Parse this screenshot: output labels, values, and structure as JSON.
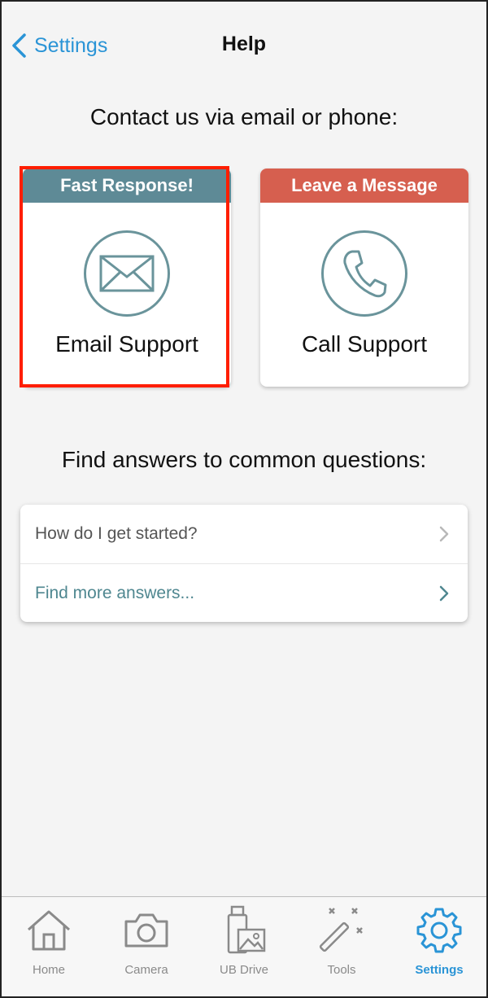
{
  "navbar": {
    "back_label": "Settings",
    "title": "Help"
  },
  "contact": {
    "heading": "Contact us via email or phone:",
    "email_card": {
      "banner": "Fast Response!",
      "label": "Email Support",
      "icon": "envelope-icon",
      "banner_color": "#5e8a96"
    },
    "call_card": {
      "banner": "Leave a Message",
      "label": "Call Support",
      "icon": "phone-icon",
      "banner_color": "#d65f4f"
    }
  },
  "faq": {
    "heading": "Find answers to common questions:",
    "items": [
      {
        "label": "How do I get started?"
      },
      {
        "label": "Find more answers..."
      }
    ]
  },
  "tabbar": {
    "items": [
      {
        "label": "Home",
        "icon": "home-icon"
      },
      {
        "label": "Camera",
        "icon": "camera-icon"
      },
      {
        "label": "UB Drive",
        "icon": "usb-drive-icon"
      },
      {
        "label": "Tools",
        "icon": "magic-wand-icon"
      },
      {
        "label": "Settings",
        "icon": "gear-icon",
        "active": true
      }
    ],
    "active_color": "#2a94d6",
    "inactive_color": "#8a8a8a"
  },
  "colors": {
    "accent": "#2a94d6",
    "highlight": "#ff1e00",
    "icon_teal": "#6a949b"
  }
}
